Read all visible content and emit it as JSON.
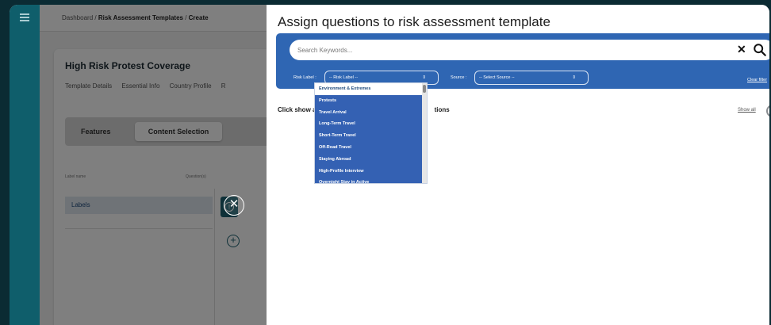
{
  "breadcrumb": {
    "root": "Dashboard",
    "sep1": " / ",
    "mid": "Risk Assessment Templates",
    "sep2": " / ",
    "leaf": "Create"
  },
  "card": {
    "title": "High Risk Protest Coverage",
    "tabs": [
      "Template Details",
      "Essential Info",
      "Country Profile",
      "R"
    ],
    "features_label": "Features",
    "content_selection_label": "Content Selection",
    "col_label_name": "Label name",
    "col_questions": "Question(s)",
    "labels_row": "Labels"
  },
  "panel": {
    "title": "Assign questions to risk assessment template",
    "search_placeholder": "Search Keywords...",
    "risk_label_caption": "Risk Label :",
    "risk_label_value": "-- Risk Label --",
    "source_caption": "Source :",
    "source_value": "-- Select Source --",
    "clear_filter": "Clear filter",
    "click_show_text_a": "Click show all c",
    "click_show_text_b": "tions",
    "show_all": "Show all"
  },
  "risk_options": [
    "Environment & Extremes",
    "Protests",
    "Travel Arrival",
    "Long-Term Travel",
    "Short-Term Travel",
    "Off-Road Travel",
    "Staying Abroad",
    "High-Profile Interview",
    "Overnight Stay in Active"
  ],
  "selected_option_index": 0,
  "colors": {
    "filter_bg": "#2f66b3",
    "sidebar": "#0f5e6b",
    "page_bg": "#0b2b33"
  },
  "icons": {
    "menu": "hamburger-icon",
    "close_overlay": "close-icon",
    "search": "search-icon",
    "clear": "clear-x-icon"
  }
}
